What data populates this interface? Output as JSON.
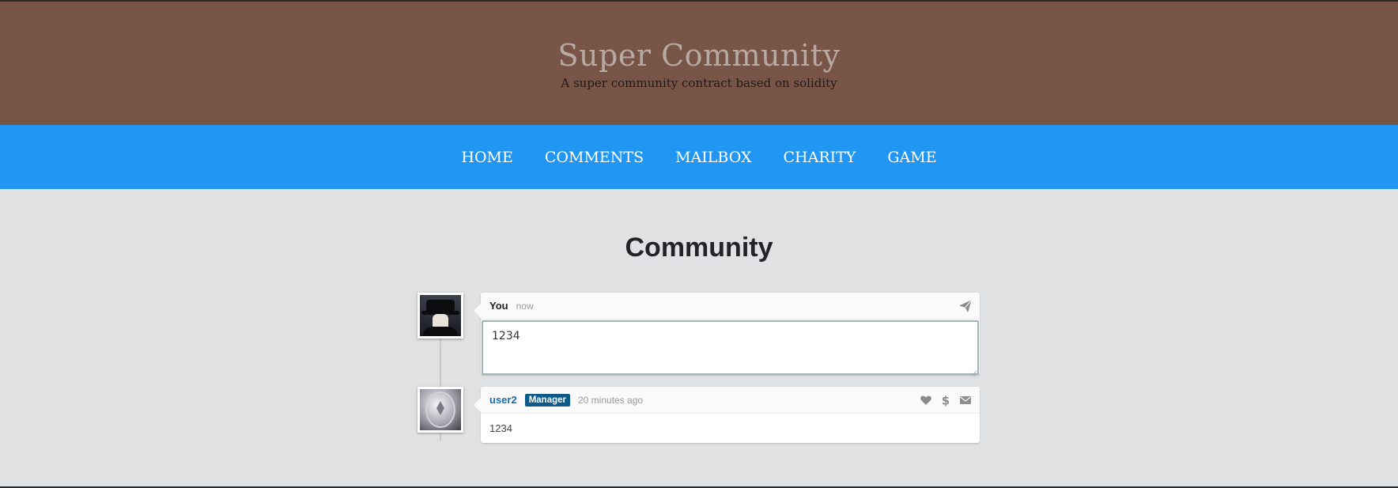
{
  "header": {
    "title": "Super Community",
    "subtitle": "A super community contract based on solidity"
  },
  "nav": {
    "items": [
      {
        "label": "HOME"
      },
      {
        "label": "COMMENTS"
      },
      {
        "label": "MAILBOX"
      },
      {
        "label": "CHARITY"
      },
      {
        "label": "GAME"
      }
    ]
  },
  "main": {
    "title": "Community",
    "composer": {
      "author": "You",
      "time": "now",
      "input_value": "1234",
      "send_icon": "paper-plane-icon"
    },
    "comments": [
      {
        "author": "user2",
        "badge": "Manager",
        "time": "20 minutes ago",
        "body": "1234",
        "icons": [
          "heart-icon",
          "dollar-icon",
          "envelope-icon"
        ]
      }
    ]
  },
  "colors": {
    "hero_bg": "#795548",
    "nav_bg": "#2196f3",
    "page_bg": "#e0e1e3",
    "link": "#1a6aa8",
    "badge_bg": "#0b5a8a"
  }
}
